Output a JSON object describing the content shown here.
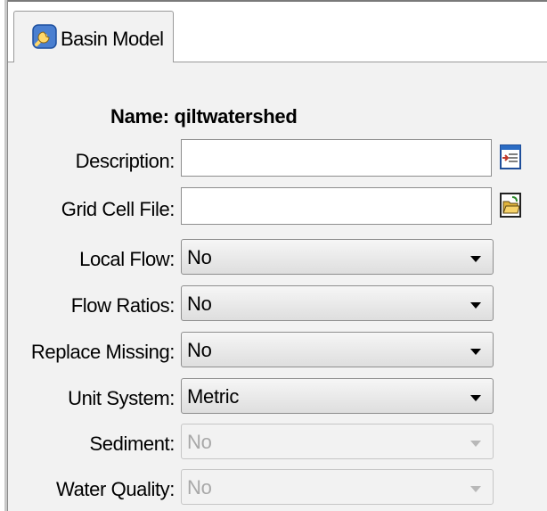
{
  "tab": {
    "label": "Basin Model",
    "icon": "wrench-basin-icon"
  },
  "name": {
    "text": "Name: qiltwatershed"
  },
  "fields": {
    "description": {
      "label": "Description:",
      "value": "",
      "button_icon": "editor-icon"
    },
    "grid_cell_file": {
      "label": "Grid Cell File:",
      "value": "",
      "button_icon": "open-folder-icon"
    },
    "local_flow": {
      "label": "Local Flow:",
      "value": "No"
    },
    "flow_ratios": {
      "label": "Flow Ratios:",
      "value": "No"
    },
    "replace_missing": {
      "label": "Replace Missing:",
      "value": "No"
    },
    "unit_system": {
      "label": "Unit System:",
      "value": "Metric"
    },
    "sediment": {
      "label": "Sediment:",
      "value": "No",
      "disabled": true
    },
    "water_quality": {
      "label": "Water Quality:",
      "value": "No",
      "disabled": true
    }
  },
  "colors": {
    "panel": "#f2f2f2",
    "disabled_text": "#a8a8a8",
    "icon_blue": "#2b6cc4",
    "folder_yellow": "#f2c84a"
  }
}
